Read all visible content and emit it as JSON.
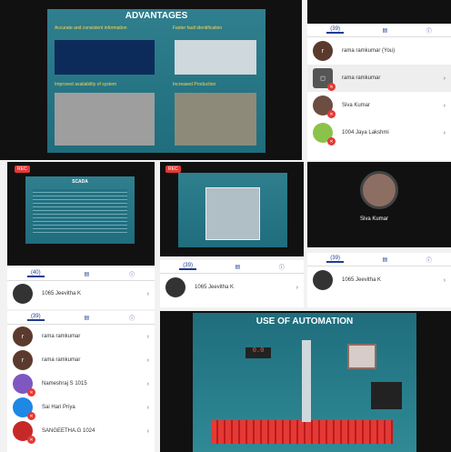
{
  "slides": {
    "advantages": {
      "title": "ADVANTAGES",
      "col1_head": "Accurate and consistent information",
      "col2_head": "Faster fault identification",
      "row2_col1": "Improved availability of system",
      "row2_col2": "Increased Production"
    },
    "scada": {
      "title": "SCADA"
    },
    "automation": {
      "title": "USE OF AUTOMATION",
      "display": "0.0"
    }
  },
  "rec_label": "REC",
  "panel_top": {
    "tabs": [
      "(39)",
      "",
      ""
    ],
    "rows": [
      {
        "name": "rama ramkumar (You)",
        "avatar": "r"
      },
      {
        "name": "rama ramkumar",
        "avatar": ""
      },
      {
        "name": "Siva Kumar",
        "avatar": ""
      },
      {
        "name": "1004 Jaya Lakshmi",
        "avatar": ""
      }
    ]
  },
  "video_tile": {
    "name": "Siva Kumar"
  },
  "panel_left_tabs": "(40)",
  "panel_left_row": "1065 Jeevitha K",
  "panel_mid_tabs": "(39)",
  "panel_mid_row": "1065 Jeevitha K",
  "panel_right_tabs": "(39)",
  "panel_right_row": "1065 Jeevitha K",
  "panel_bottom": {
    "tabs": "(39)",
    "rows": [
      {
        "name": "rama ramkumar",
        "avatar": "r"
      },
      {
        "name": "rama ramkumar",
        "avatar": "r"
      },
      {
        "name": "Nameshraj S 1015",
        "avatar": ""
      },
      {
        "name": "Sai Hari Priya",
        "avatar": ""
      },
      {
        "name": "SANGEETHA.G 1024",
        "avatar": ""
      }
    ]
  }
}
